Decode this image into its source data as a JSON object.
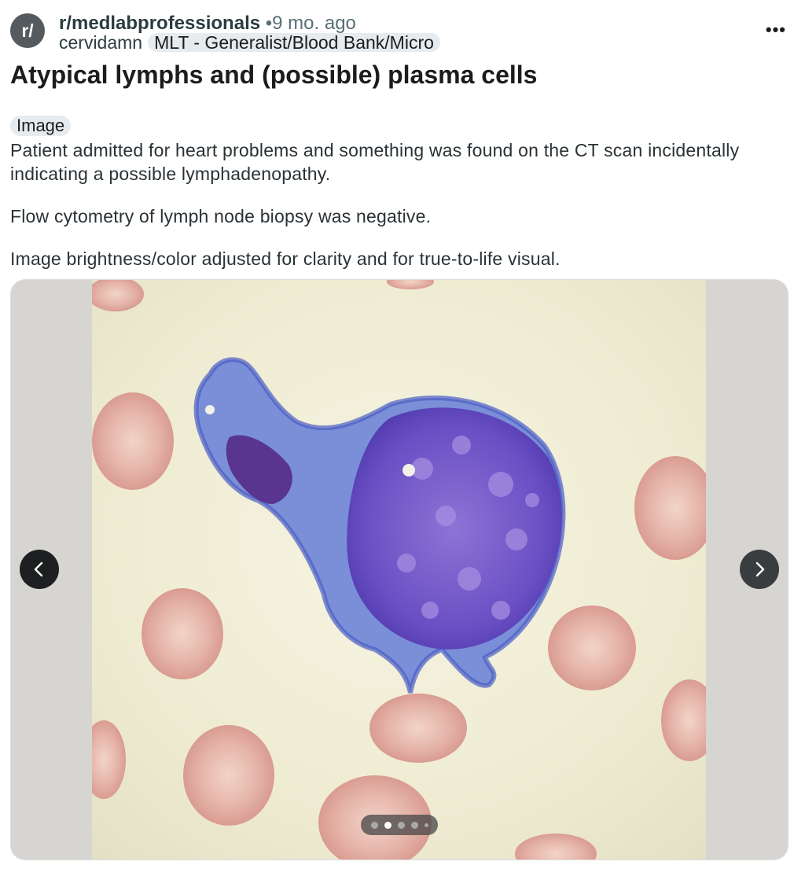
{
  "post_header": {
    "avatar_text": "r/",
    "subreddit": "r/medlabprofessionals",
    "separator": "•",
    "time_ago": "9 mo. ago",
    "username": "cervidamn",
    "user_flair": "MLT - Generalist/Blood Bank/Micro",
    "more_label": "•••"
  },
  "post": {
    "title": "Atypical lymphs and (possible) plasma cells",
    "tag": "Image",
    "paragraphs": [
      "Patient admitted for heart problems and something was found on the CT scan incidentally indicating a possible lymphadenopathy.",
      "Flow cytometry of lymph node biopsy was negative.",
      "Image brightness/color adjusted for clarity and for true-to-life visual."
    ]
  },
  "gallery": {
    "image_count": 5,
    "current_index": 2,
    "prev_icon": "chevron-left-icon",
    "next_icon": "chevron-right-icon"
  },
  "colors": {
    "avatar_bg": "#555a5e",
    "flair_bg": "#e5ebee",
    "cell_purple": "#5b3fb5",
    "rbc_pink": "#e0a9a0"
  }
}
